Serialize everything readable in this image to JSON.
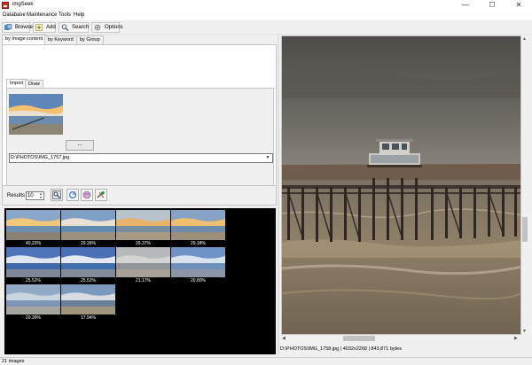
{
  "window": {
    "title": "imgSeek",
    "controls": [
      "—",
      "☐",
      "✕"
    ]
  },
  "menu": [
    "Database",
    "Maintenance",
    "Tools",
    "Help"
  ],
  "toolbar": {
    "browse": "Browse",
    "add": "Add",
    "search": "Search",
    "options": "Options"
  },
  "tabs": [
    "by Image content",
    "by Keyword",
    "by Group"
  ],
  "inner_tabs": [
    "Import",
    "Draw"
  ],
  "query": {
    "browse_button": "...",
    "path": "D:\\PHOTOS\\IMG_1757.jpg"
  },
  "results": {
    "label": "Results",
    "count": "10"
  },
  "thumbnails": [
    {
      "score": "40.23%",
      "sky": "#8aa7c9",
      "cloud": "#f2c77a",
      "sea": "#6f8fb0",
      "ground": "#8a8375"
    },
    {
      "score": "29.39%",
      "sky": "#7fa0c4",
      "cloud": "#e9e1d3",
      "sea": "#5f8ab2",
      "ground": "#9c917d"
    },
    {
      "score": "29.37%",
      "sky": "#b8c3cc",
      "cloud": "#e8b46a",
      "sea": "#788ea0",
      "ground": "#a89b85"
    },
    {
      "score": "29.18%",
      "sky": "#86a3c6",
      "cloud": "#f0c070",
      "sea": "#6d8bac",
      "ground": "#9a8f78"
    },
    {
      "score": "25.52%",
      "sky": "#4f74b8",
      "cloud": "#dfe6f0",
      "sea": "#3e68a8",
      "ground": "#7d8797"
    },
    {
      "score": "25.52%",
      "sky": "#4b70b5",
      "cloud": "#e4e9f1",
      "sea": "#4270ab",
      "ground": "#808a99"
    },
    {
      "score": "21.17%",
      "sky": "#b7babb",
      "cloud": "#d4d4d2",
      "sea": "#8f9497",
      "ground": "#a7a198"
    },
    {
      "score": "20.80%",
      "sky": "#6f93c4",
      "cloud": "#d9e2ef",
      "sea": "#6d8fb8",
      "ground": "#8b95a5"
    },
    {
      "score": "20.39%",
      "sky": "#93aac6",
      "cloud": "#c8d4e0",
      "sea": "#7d96b3",
      "ground": "#a6a5a0"
    },
    {
      "score": "17.94%",
      "sky": "#7b98bd",
      "cloud": "#d8dde4",
      "sea": "#6a7f98",
      "ground": "#a2957e"
    }
  ],
  "image_info": "D:\\PHOTOS\\IMG_1758.jpg | 4032x2268 | 843.871 bytes",
  "status": "21 images"
}
